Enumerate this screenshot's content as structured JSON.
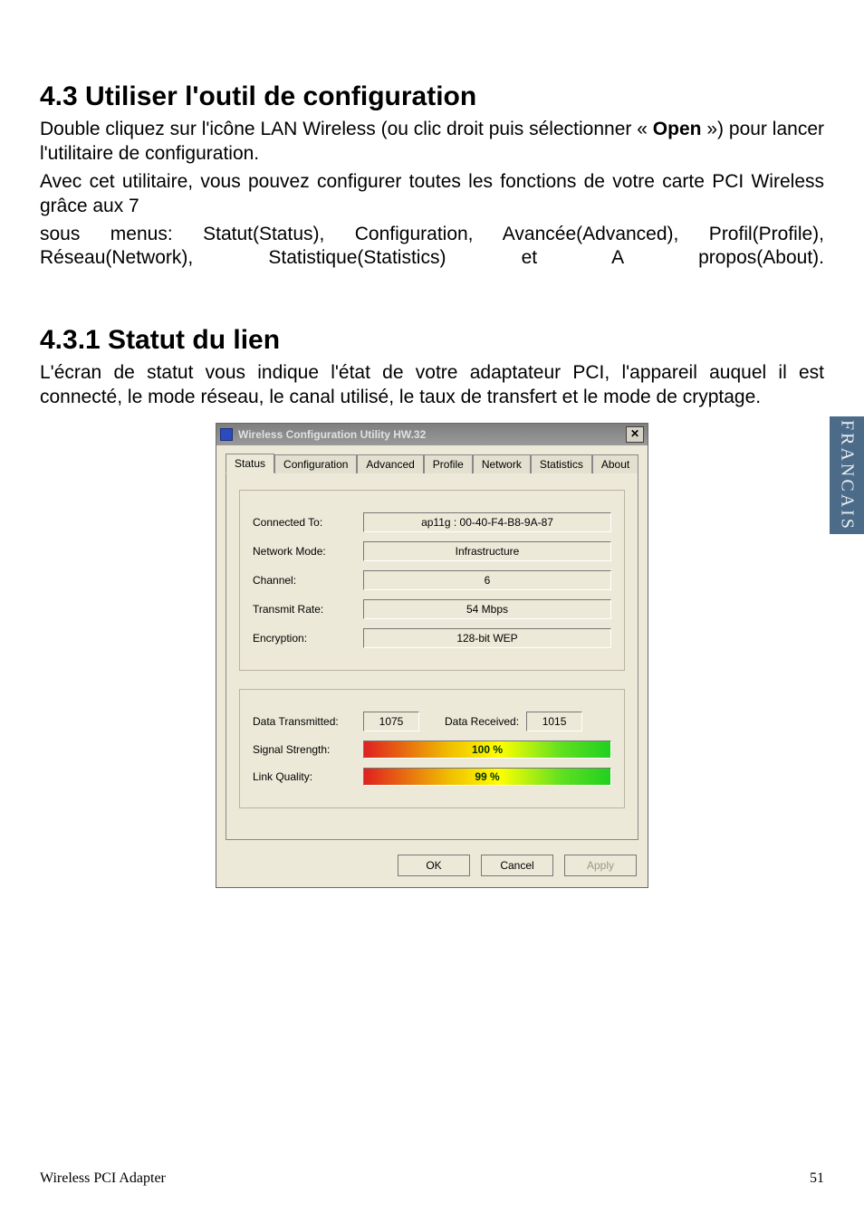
{
  "sideTab": "FRANCAIS",
  "section1": {
    "heading": "4.3 Utiliser l'outil de configuration",
    "p1a": "Double cliquez sur l'icône LAN Wireless (ou clic droit puis sélectionner « ",
    "p1b": "Open",
    "p1c": " ») pour lancer l'utilitaire de configuration.",
    "p2": "Avec cet utilitaire, vous pouvez configurer toutes les fonctions de votre carte PCI Wireless grâce aux 7",
    "p3": "sous menus: Statut(Status), Configuration, Avancée(Advanced), Profil(Profile), Réseau(Network), Statistique(Statistics) et A propos(About)."
  },
  "section2": {
    "heading": "4.3.1 Statut du lien",
    "p1": "L'écran de statut vous indique l'état de votre adaptateur PCI, l'appareil auquel il est connecté, le mode réseau, le canal utilisé, le taux de transfert et le mode de cryptage."
  },
  "dialog": {
    "title": "Wireless Configuration Utility HW.32",
    "closeGlyph": "✕",
    "tabs": [
      "Status",
      "Configuration",
      "Advanced",
      "Profile",
      "Network",
      "Statistics",
      "About"
    ],
    "activeTab": 0,
    "fields": {
      "connectedToLabel": "Connected To:",
      "connectedToValue": "ap11g : 00-40-F4-B8-9A-87",
      "networkModeLabel": "Network Mode:",
      "networkModeValue": "Infrastructure",
      "channelLabel": "Channel:",
      "channelValue": "6",
      "transmitRateLabel": "Transmit Rate:",
      "transmitRateValue": "54 Mbps",
      "encryptionLabel": "Encryption:",
      "encryptionValue": "128-bit WEP",
      "dataTxLabel": "Data Transmitted:",
      "dataTxValue": "1075",
      "dataRxLabel": "Data Received:",
      "dataRxValue": "1015",
      "signalLabel": "Signal Strength:",
      "signalValue": "100 %",
      "linkLabel": "Link Quality:",
      "linkValue": "99 %"
    },
    "buttons": {
      "ok": "OK",
      "cancel": "Cancel",
      "apply": "Apply"
    }
  },
  "footer": {
    "left": "Wireless PCI Adapter",
    "right": "51"
  }
}
